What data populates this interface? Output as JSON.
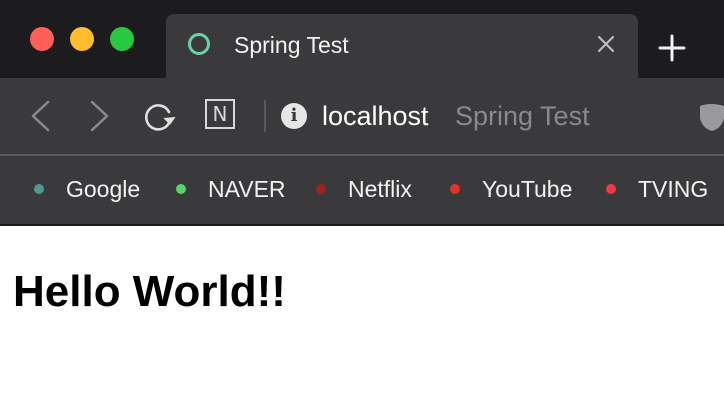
{
  "window": {
    "traffic_lights": {
      "close": "#fe5f57",
      "minimize": "#febc2e",
      "maximize": "#28c840"
    }
  },
  "tab": {
    "title": "Spring Test",
    "favicon": "ring-icon",
    "favicon_color": "#6ad0a6"
  },
  "toolbar": {
    "url_host": "localhost",
    "url_page_title": "Spring Test",
    "n_button_label": "N"
  },
  "bookmarks": [
    {
      "label": "Google",
      "color": "#4f9a8f"
    },
    {
      "label": "NAVER",
      "color": "#52d66a"
    },
    {
      "label": "Netflix",
      "color": "#a0231f"
    },
    {
      "label": "YouTube",
      "color": "#e33228"
    },
    {
      "label": "TVING",
      "color": "#ec3a45"
    }
  ],
  "page": {
    "heading": "Hello World!!"
  }
}
